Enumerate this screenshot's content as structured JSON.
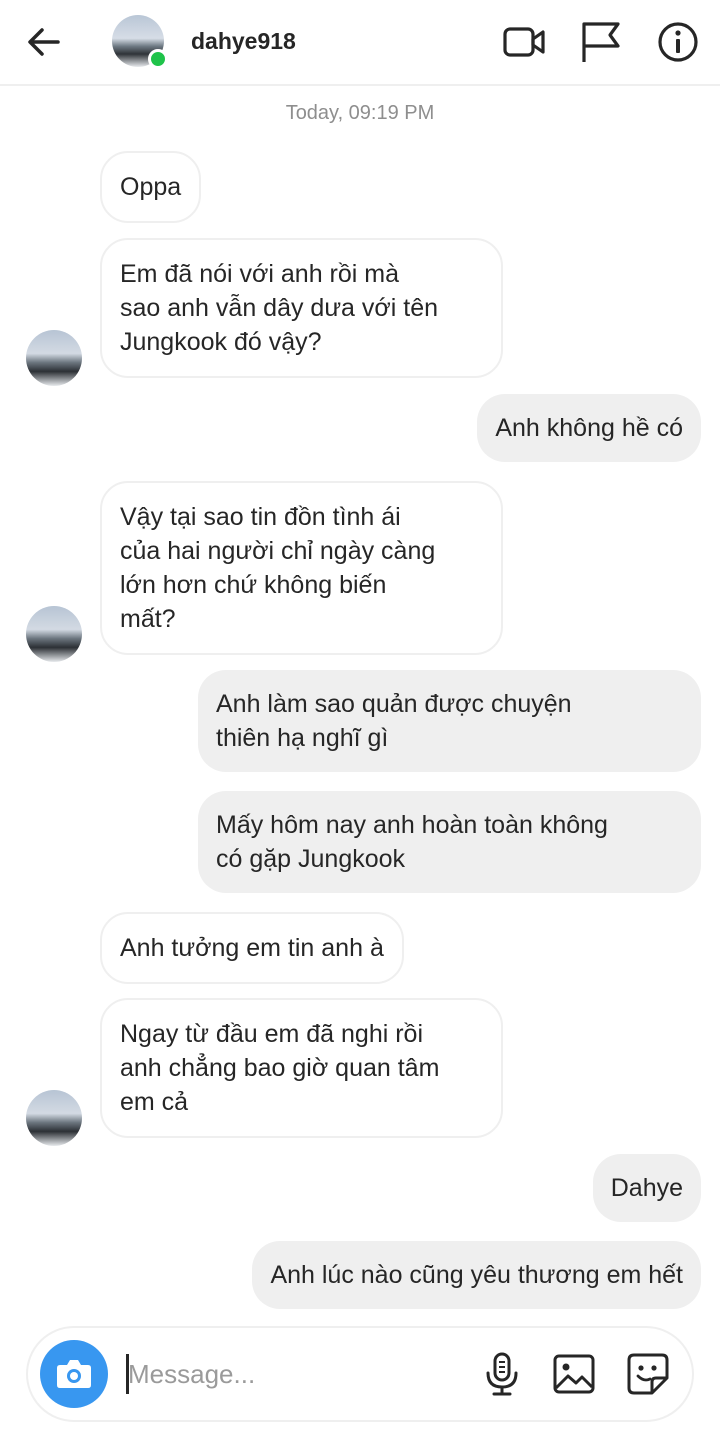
{
  "header": {
    "username": "dahye918",
    "icons": [
      "back-arrow-icon",
      "video-call-icon",
      "flag-icon",
      "info-icon"
    ],
    "online_color": "#1fc34a"
  },
  "timestamp": "Today, 09:19 PM",
  "messages": [
    {
      "from": "them",
      "lines": [
        "Oppa"
      ]
    },
    {
      "from": "them",
      "lines": [
        "Em đã nói với anh rồi mà",
        "sao anh vẫn dây dưa với tên",
        "Jungkook đó vậy?"
      ]
    },
    {
      "from": "me",
      "lines": [
        "Anh không hề có"
      ]
    },
    {
      "from": "them",
      "lines": [
        "Vậy tại sao tin đồn tình ái",
        "của hai người chỉ ngày càng",
        "lớn hơn chứ không biến",
        "mất?"
      ]
    },
    {
      "from": "me",
      "lines": [
        "Anh làm sao quản được chuyện",
        "thiên hạ nghĩ gì"
      ]
    },
    {
      "from": "me",
      "lines": [
        "Mấy hôm nay anh hoàn toàn không",
        "có gặp Jungkook"
      ]
    },
    {
      "from": "them",
      "lines": [
        "Anh tưởng em tin anh à"
      ]
    },
    {
      "from": "them",
      "lines": [
        "Ngay từ đầu em đã nghi rồi",
        "anh chẳng bao giờ quan tâm",
        "em cả"
      ]
    },
    {
      "from": "me",
      "lines": [
        "Dahye"
      ]
    },
    {
      "from": "me",
      "lines": [
        "Anh lúc nào cũng yêu thương em hết"
      ]
    }
  ],
  "composer": {
    "placeholder": "Message...",
    "icons": [
      "camera-icon",
      "microphone-icon",
      "gallery-icon",
      "sticker-icon"
    ],
    "camera_color": "#3897f0"
  }
}
